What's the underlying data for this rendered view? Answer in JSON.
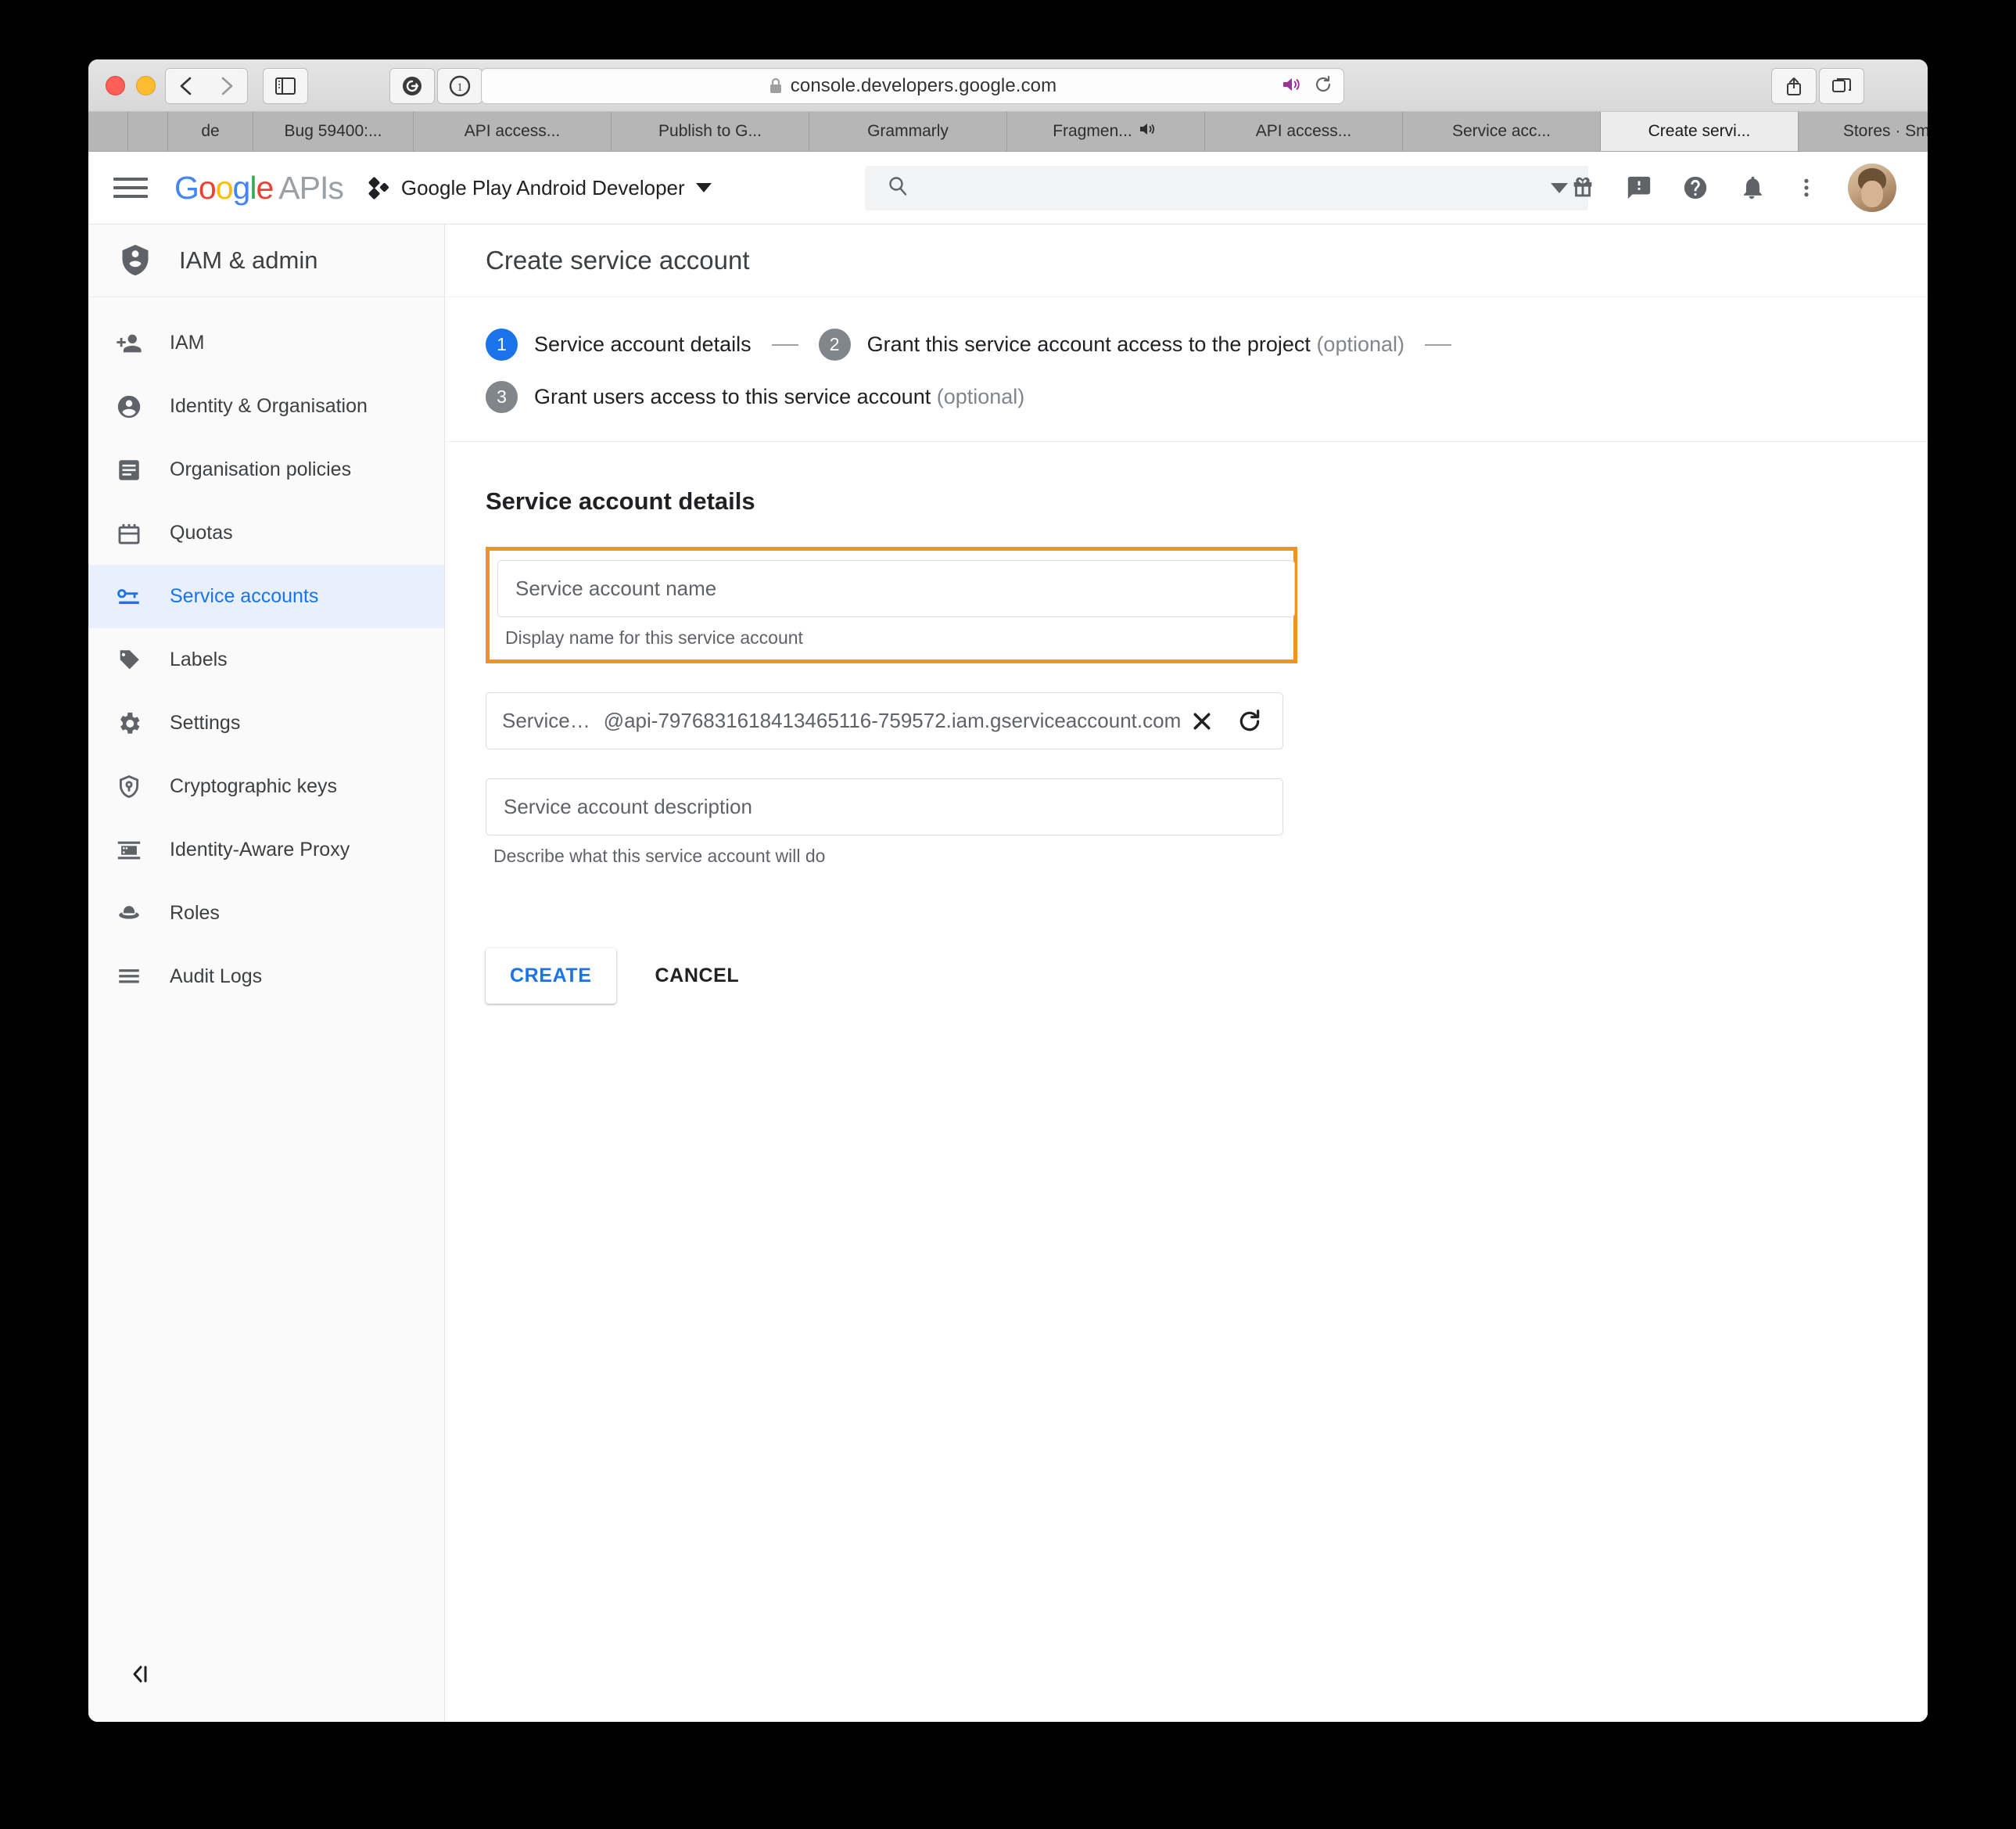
{
  "browser": {
    "url": "console.developers.google.com",
    "lock_icon": "lock-icon",
    "back_icon": "chevron-left-icon",
    "forward_icon": "chevron-right-icon",
    "sidebar_icon": "sidebar-toggle-icon",
    "grammarly_icon": "grammarly-extension-icon",
    "onepassword_icon": "onepassword-extension-icon",
    "audio_icon": "speaker-playing-icon",
    "reload_icon": "reload-icon",
    "share_icon": "share-icon",
    "tab_overview_icon": "tab-overview-icon",
    "new_tab_label": "+",
    "tabs": [
      {
        "label": "de",
        "active": false,
        "audio": false
      },
      {
        "label": "Bug 59400:...",
        "active": false,
        "audio": false
      },
      {
        "label": "API access...",
        "active": false,
        "audio": false
      },
      {
        "label": "Publish to G...",
        "active": false,
        "audio": false
      },
      {
        "label": "Grammarly",
        "active": false,
        "audio": false
      },
      {
        "label": "Fragmen...",
        "active": false,
        "audio": true
      },
      {
        "label": "API access...",
        "active": false,
        "audio": false
      },
      {
        "label": "Service acc...",
        "active": false,
        "audio": false
      },
      {
        "label": "Create servi...",
        "active": true,
        "audio": false
      },
      {
        "label": "Stores · Sm...",
        "active": false,
        "audio": false
      }
    ]
  },
  "header": {
    "menu_icon": "hamburger-menu-icon",
    "logo": {
      "g1": "G",
      "o1": "o",
      "o2": "o",
      "g2": "g",
      "l": "l",
      "e": "e",
      "apis": "APIs"
    },
    "project_name": "Google Play Android Developer",
    "project_icon": "project-selector-icon",
    "project_caret": "chevron-down-icon",
    "search": {
      "value": "",
      "placeholder": "",
      "icon": "search-icon",
      "caret": "chevron-down-icon"
    },
    "icons": [
      {
        "name": "gift-icon"
      },
      {
        "name": "feedback-icon"
      },
      {
        "name": "help-icon"
      },
      {
        "name": "notifications-bell-icon"
      },
      {
        "name": "more-vert-icon"
      }
    ],
    "avatar": "user-avatar"
  },
  "sidebar": {
    "title": "IAM & admin",
    "title_icon": "iam-shield-icon",
    "collapse_icon": "collapse-panel-icon",
    "items": [
      {
        "label": "IAM",
        "icon": "person-add-icon",
        "active": false
      },
      {
        "label": "Identity & Organisation",
        "icon": "account-circle-icon",
        "active": false
      },
      {
        "label": "Organisation policies",
        "icon": "policy-document-icon",
        "active": false
      },
      {
        "label": "Quotas",
        "icon": "quotas-icon",
        "active": false
      },
      {
        "label": "Service accounts",
        "icon": "key-card-icon",
        "active": true
      },
      {
        "label": "Labels",
        "icon": "label-tag-icon",
        "active": false
      },
      {
        "label": "Settings",
        "icon": "gear-icon",
        "active": false
      },
      {
        "label": "Cryptographic keys",
        "icon": "shield-key-icon",
        "active": false
      },
      {
        "label": "Identity-Aware Proxy",
        "icon": "iap-icon",
        "active": false
      },
      {
        "label": "Roles",
        "icon": "roles-hat-icon",
        "active": false
      },
      {
        "label": "Audit Logs",
        "icon": "audit-logs-icon",
        "active": false
      }
    ]
  },
  "main": {
    "page_title": "Create service account",
    "stepper": [
      {
        "num": "1",
        "label": "Service account details",
        "optional": "",
        "state": "on"
      },
      {
        "num": "2",
        "label": "Grant this service account access to the project",
        "optional": "(optional)",
        "state": "off"
      },
      {
        "num": "3",
        "label": "Grant users access to this service account",
        "optional": "(optional)",
        "state": "off"
      }
    ],
    "section_title": "Service account details",
    "name_field": {
      "value": "",
      "placeholder": "Service account name",
      "hint": "Display name for this service account",
      "highlighted": true,
      "highlight_color": "#f29127"
    },
    "id_field": {
      "prefix": "Service…",
      "domain": "@api-7976831618413465116-759572.iam.gserviceaccount.com",
      "clear_icon": "close-x-icon",
      "refresh_icon": "refresh-icon"
    },
    "description_field": {
      "value": "",
      "placeholder": "Service account description",
      "hint": "Describe what this service account will do"
    },
    "create_label": "CREATE",
    "cancel_label": "CANCEL",
    "accent_color": "#1a73e8"
  }
}
